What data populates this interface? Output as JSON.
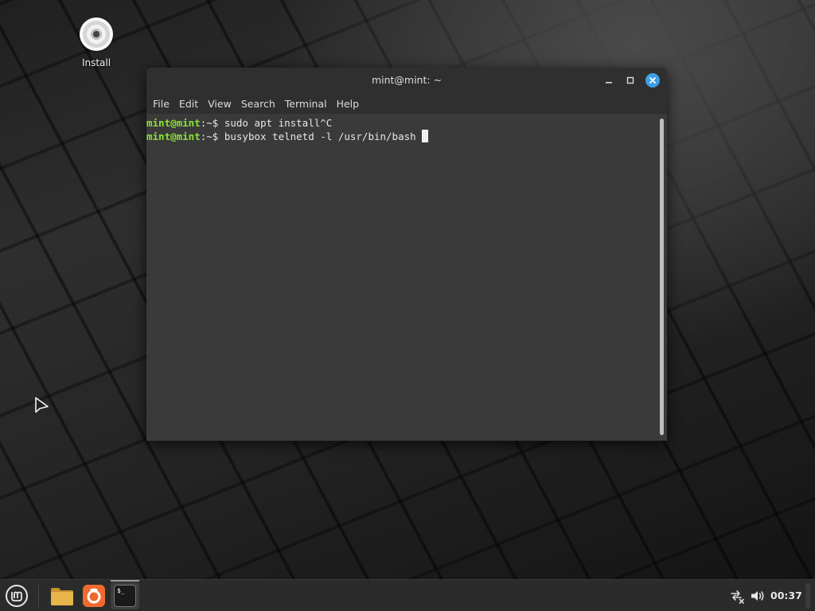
{
  "desktop": {
    "icons": [
      {
        "label": "Install",
        "icon": "disc-icon"
      }
    ]
  },
  "window": {
    "title": "mint@mint: ~",
    "menu": [
      "File",
      "Edit",
      "View",
      "Search",
      "Terminal",
      "Help"
    ],
    "lines": [
      {
        "user": "mint@mint",
        "sep": ":~$ ",
        "command": "sudo apt install^C"
      },
      {
        "user": "mint@mint",
        "sep": ":~$ ",
        "command": "busybox telnetd -l /usr/bin/bash "
      }
    ]
  },
  "taskbar": {
    "launchers": [
      "menu-icon",
      "folder-icon",
      "firefox-icon",
      "terminal-icon"
    ],
    "terminal_icon_text": "$_",
    "clock": "00:37"
  },
  "colors": {
    "prompt_user": "#8ae234",
    "close_button": "#3d9ee6",
    "terminal_bg": "#3a3a3a",
    "folder": "#e8b54a",
    "firefox": "#f06a30"
  }
}
